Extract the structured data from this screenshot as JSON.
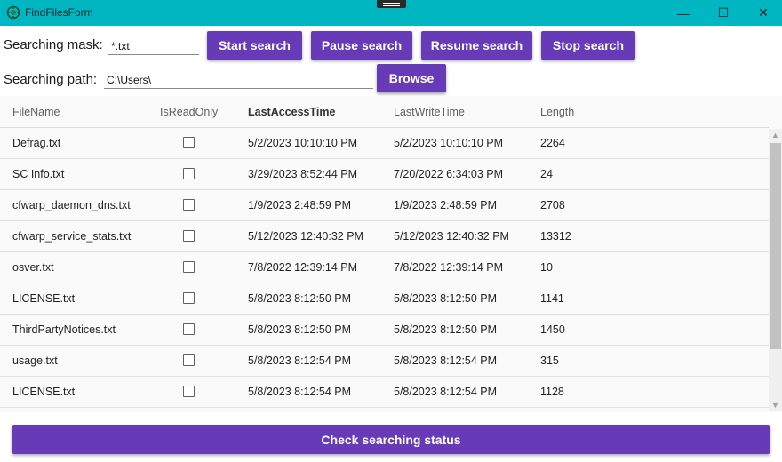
{
  "window": {
    "title": "FindFilesForm",
    "icons": {
      "app": "app-icon",
      "minimize": "minimize-icon",
      "maximize": "maximize-icon",
      "close": "close-icon"
    },
    "minimize_glyph": "—",
    "maximize_glyph": "☐",
    "close_glyph": "✕"
  },
  "search": {
    "mask_label": "Searching mask:",
    "mask_value": "*.txt",
    "path_label": "Searching path:",
    "path_value": "C:\\Users\\"
  },
  "buttons": {
    "start": "Start search",
    "pause": "Pause search",
    "resume": "Resume search",
    "stop": "Stop search",
    "browse": "Browse",
    "check_status": "Check searching status"
  },
  "grid": {
    "columns": [
      "FileName",
      "IsReadOnly",
      "LastAccessTime",
      "LastWriteTime",
      "Length"
    ],
    "rows": [
      {
        "name": "Defrag.txt",
        "readonly": false,
        "access": "5/2/2023 10:10:10 PM",
        "write": "5/2/2023 10:10:10 PM",
        "length": "2264"
      },
      {
        "name": "SC Info.txt",
        "readonly": false,
        "access": "3/29/2023 8:52:44 PM",
        "write": "7/20/2022 6:34:03 PM",
        "length": "24"
      },
      {
        "name": "cfwarp_daemon_dns.txt",
        "readonly": false,
        "access": "1/9/2023 2:48:59 PM",
        "write": "1/9/2023 2:48:59 PM",
        "length": "2708"
      },
      {
        "name": "cfwarp_service_stats.txt",
        "readonly": false,
        "access": "5/12/2023 12:40:32 PM",
        "write": "5/12/2023 12:40:32 PM",
        "length": "13312"
      },
      {
        "name": "osver.txt",
        "readonly": false,
        "access": "7/8/2022 12:39:14 PM",
        "write": "7/8/2022 12:39:14 PM",
        "length": "10"
      },
      {
        "name": "LICENSE.txt",
        "readonly": false,
        "access": "5/8/2023 8:12:50 PM",
        "write": "5/8/2023 8:12:50 PM",
        "length": "1141"
      },
      {
        "name": "ThirdPartyNotices.txt",
        "readonly": false,
        "access": "5/8/2023 8:12:50 PM",
        "write": "5/8/2023 8:12:50 PM",
        "length": "1450"
      },
      {
        "name": "usage.txt",
        "readonly": false,
        "access": "5/8/2023 8:12:54 PM",
        "write": "5/8/2023 8:12:54 PM",
        "length": "315"
      },
      {
        "name": "LICENSE.txt",
        "readonly": false,
        "access": "5/8/2023 8:12:54 PM",
        "write": "5/8/2023 8:12:54 PM",
        "length": "1128"
      }
    ]
  },
  "scrollbar": {
    "up_glyph": "▲",
    "down_glyph": "▼"
  },
  "colors": {
    "titlebar": "#00b6c0",
    "accent": "#673ab7",
    "grid_background": "#fafafa"
  }
}
